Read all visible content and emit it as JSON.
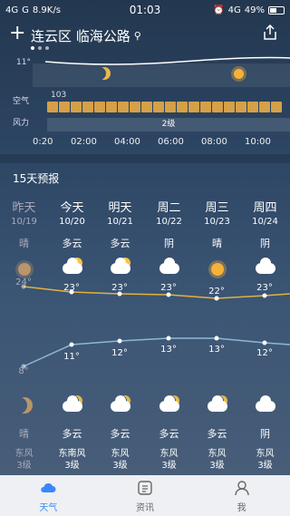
{
  "status": {
    "signal": "4G",
    "signal2": "G",
    "speed": "8.9K/s",
    "time": "01:03",
    "net": "4G",
    "battery": "49%"
  },
  "header": {
    "location": "连云区 临海公路"
  },
  "hourly": {
    "temp_label": "11°",
    "aqi_label": "空气",
    "aqi_value": "103",
    "wind_label": "风力",
    "wind_value": "2级",
    "times": [
      "0:20",
      "02:00",
      "04:00",
      "06:00",
      "08:00",
      "10:00"
    ]
  },
  "forecast": {
    "title": "15天预报",
    "days": [
      {
        "name": "昨天",
        "date": "10/19",
        "desc": "晴",
        "high": "24°",
        "low": "8°",
        "ndesc": "晴",
        "wind_dir": "东风",
        "wind_lv": "3级",
        "aqi": "轻度"
      },
      {
        "name": "今天",
        "date": "10/20",
        "desc": "多云",
        "high": "23°",
        "low": "11°",
        "ndesc": "多云",
        "wind_dir": "东南风",
        "wind_lv": "3级",
        "aqi": "轻度"
      },
      {
        "name": "明天",
        "date": "10/21",
        "desc": "多云",
        "high": "23°",
        "low": "12°",
        "ndesc": "多云",
        "wind_dir": "东风",
        "wind_lv": "3级",
        "aqi": "良"
      },
      {
        "name": "周二",
        "date": "10/22",
        "desc": "阴",
        "high": "23°",
        "low": "13°",
        "ndesc": "多云",
        "wind_dir": "东风",
        "wind_lv": "3级",
        "aqi": "良"
      },
      {
        "name": "周三",
        "date": "10/23",
        "desc": "晴",
        "high": "22°",
        "low": "13°",
        "ndesc": "多云",
        "wind_dir": "东风",
        "wind_lv": "3级",
        "aqi": "良"
      },
      {
        "name": "周四",
        "date": "10/24",
        "desc": "阴",
        "high": "23°",
        "low": "12°",
        "ndesc": "阴",
        "wind_dir": "东风",
        "wind_lv": "3级",
        "aqi": "良"
      }
    ]
  },
  "tabs": [
    {
      "label": "天气"
    },
    {
      "label": "资讯"
    },
    {
      "label": "我"
    }
  ],
  "colors": {
    "accent": "#3a86ff",
    "high_line": "#e3b23c",
    "low_line": "#8fb7d6"
  }
}
